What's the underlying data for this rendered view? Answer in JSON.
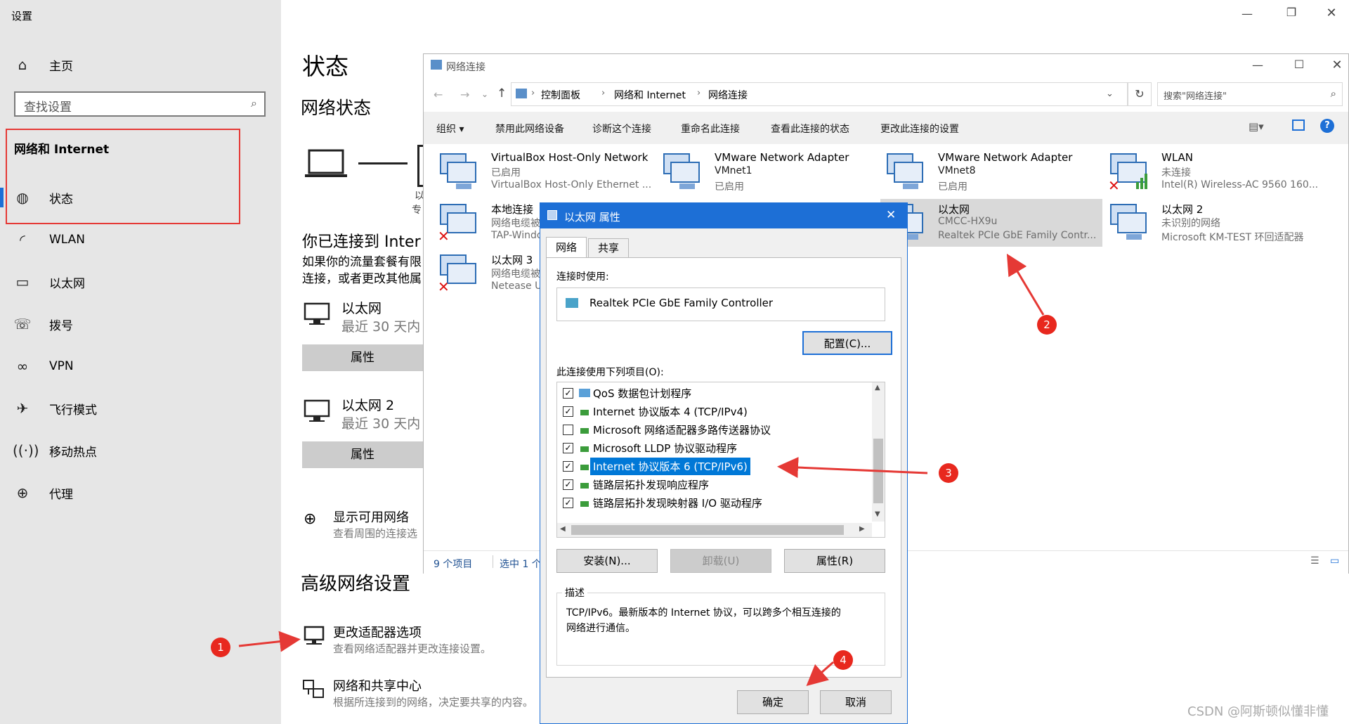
{
  "settings": {
    "title": "设置",
    "nav": {
      "home": "主页",
      "search_placeholder": "查找设置",
      "section": "网络和 Internet",
      "items": [
        "状态",
        "WLAN",
        "以太网",
        "拨号",
        "VPN",
        "飞行模式",
        "移动热点",
        "代理"
      ]
    },
    "main": {
      "page_title": "状态",
      "network_status": "网络状态",
      "diagram_label1": "以",
      "diagram_label2": "专",
      "connected_text": "你已连接到 Inter",
      "metered_text1": "如果你的流量套餐有限",
      "metered_text2": "连接，或者更改其他属",
      "connections": [
        {
          "name": "以太网",
          "sub": "最近 30 天内",
          "button": "属性"
        },
        {
          "name": "以太网 2",
          "sub": "最近 30 天内",
          "button": "属性"
        }
      ],
      "show_networks": "显示可用网络",
      "show_networks_sub": "查看周围的连接选",
      "advanced_title": "高级网络设置",
      "adapter_options": "更改适配器选项",
      "adapter_options_sub": "查看网络适配器并更改连接设置。",
      "sharing_center": "网络和共享中心",
      "sharing_center_sub": "根据所连接到的网络，决定要共享的内容。"
    }
  },
  "netconn": {
    "title": "网络连接",
    "breadcrumb": [
      "控制面板",
      "网络和 Internet",
      "网络连接"
    ],
    "search_placeholder": "搜索\"网络连接\"",
    "toolbar": [
      "组织 ▾",
      "禁用此网络设备",
      "诊断这个连接",
      "重命名此连接",
      "查看此连接的状态",
      "更改此连接的设置"
    ],
    "adapters": [
      {
        "name": "VirtualBox Host-Only Network",
        "status": "已启用",
        "device": "VirtualBox Host-Only Ethernet ..."
      },
      {
        "name": "VMware Network Adapter",
        "status": "VMnet1",
        "device": "已启用"
      },
      {
        "name": "VMware Network Adapter",
        "status": "VMnet8",
        "device": "已启用"
      },
      {
        "name": "WLAN",
        "status": "未连接",
        "device": "Intel(R) Wireless-AC 9560 160..."
      },
      {
        "name": "本地连接",
        "status": "网络电缆被拔",
        "device": "TAP-Windo"
      },
      {
        "name": "以太网",
        "status": "CMCC-HX9u",
        "device": "Realtek PCIe GbE Family Contr..."
      },
      {
        "name": "以太网 2",
        "status": "未识别的网络",
        "device": "Microsoft KM-TEST 环回适配器"
      },
      {
        "name": "以太网 3",
        "status": "网络电缆被拔",
        "device": "Netease Ul"
      }
    ],
    "status_count": "9 个项目",
    "status_selected": "选中 1 个项"
  },
  "dialog": {
    "title": "以太网 属性",
    "tabs": [
      "网络",
      "共享"
    ],
    "connect_using_label": "连接时使用:",
    "adapter_name": "Realtek PCIe GbE Family Controller",
    "configure_button": "配置(C)...",
    "items_label": "此连接使用下列项目(O):",
    "items": [
      {
        "label": "QoS 数据包计划程序",
        "checked": true
      },
      {
        "label": "Internet 协议版本 4 (TCP/IPv4)",
        "checked": true
      },
      {
        "label": "Microsoft 网络适配器多路传送器协议",
        "checked": false
      },
      {
        "label": "Microsoft LLDP 协议驱动程序",
        "checked": true
      },
      {
        "label": "Internet 协议版本 6 (TCP/IPv6)",
        "checked": true,
        "selected": true
      },
      {
        "label": "链路层拓扑发现响应程序",
        "checked": true
      },
      {
        "label": "链路层拓扑发现映射器 I/O 驱动程序",
        "checked": true
      }
    ],
    "install_button": "安装(N)...",
    "uninstall_button": "卸载(U)",
    "properties_button": "属性(R)",
    "description_label": "描述",
    "description_text1": "TCP/IPv6。最新版本的 Internet 协议，可以跨多个相互连接的",
    "description_text2": "网络进行通信。",
    "ok_button": "确定",
    "cancel_button": "取消"
  },
  "annotations": [
    "1",
    "2",
    "3",
    "4"
  ],
  "watermark": "CSDN @阿斯顿似懂非懂",
  "colors": {
    "accent": "#1d6fd6",
    "annotation": "#e8281e",
    "highlight_box": "#e53935",
    "selection": "#0078d7"
  }
}
